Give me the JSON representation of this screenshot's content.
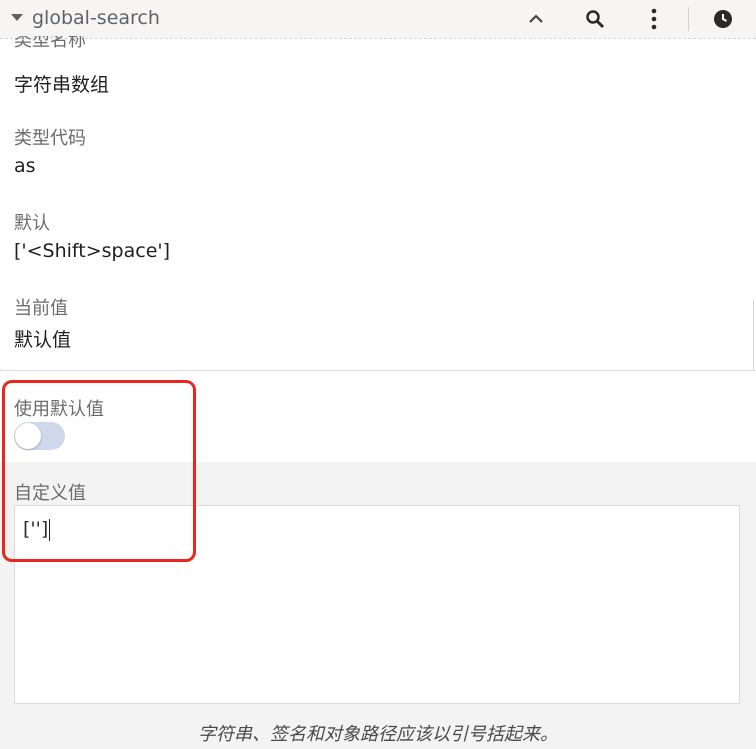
{
  "header": {
    "title": "global-search",
    "icons": [
      "triangle-down-icon",
      "chevron-up-icon",
      "search-icon",
      "kebab-menu-icon",
      "clock-icon"
    ]
  },
  "fields": {
    "type_name_label": "类型名称",
    "type_name_value": "字符串数组",
    "type_code_label": "类型代码",
    "type_code_value": "as",
    "default_label": "默认",
    "default_value": "['<Shift>space']",
    "current_label": "当前值",
    "current_value": "默认值"
  },
  "use_default": {
    "label": "使用默认值",
    "enabled": false
  },
  "custom": {
    "label": "自定义值",
    "value": "['']"
  },
  "footer_note": "字符串、签名和对象路径应该以引号括起来。",
  "colors": {
    "highlight": "#e8281e",
    "toggle_track": "#cfd7ea"
  }
}
